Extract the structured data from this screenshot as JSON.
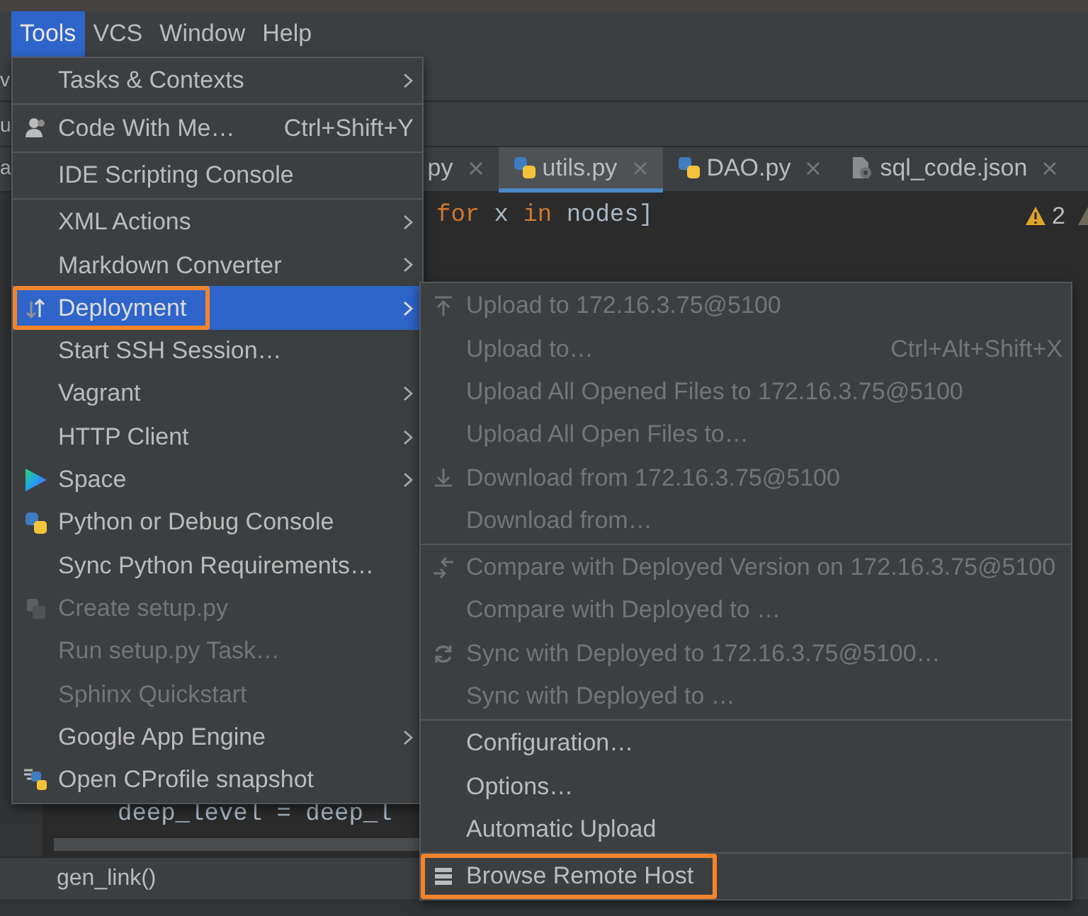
{
  "menubar": [
    {
      "label": "Tools",
      "selected": true
    },
    {
      "label": "VCS",
      "selected": false
    },
    {
      "label": "Window",
      "selected": false
    },
    {
      "label": "Help",
      "selected": false
    }
  ],
  "toolbar_fragments": [
    "v",
    "u"
  ],
  "tabs": [
    {
      "label": "a",
      "selected": false,
      "kind": "plain",
      "closable": false
    },
    {
      "label": "py",
      "selected": false,
      "kind": "plain",
      "closable": true
    },
    {
      "label": "utils.py",
      "selected": true,
      "kind": "python",
      "closable": true
    },
    {
      "label": "DAO.py",
      "selected": false,
      "kind": "python",
      "closable": true
    },
    {
      "label": "sql_code.json",
      "selected": false,
      "kind": "json",
      "closable": true
    }
  ],
  "editor": {
    "lines": [
      [
        {
          "text": "for",
          "kind": "keyword"
        },
        {
          "text": " x ",
          "kind": "plain"
        },
        {
          "text": "in",
          "kind": "keyword"
        },
        {
          "text": " nodes]",
          "kind": "plain"
        }
      ],
      [
        {
          "text": "deep_level = deep_l",
          "kind": "plain"
        }
      ]
    ],
    "warning_count": "2"
  },
  "breadcrumb": "gen_link()",
  "tools_menu": {
    "sections": [
      {
        "items": [
          {
            "label": "Tasks & Contexts",
            "kind": "none",
            "has_submenu": true,
            "disabled": false,
            "selected": false
          }
        ]
      },
      {
        "items": [
          {
            "label": "Code With Me…",
            "kind": "person",
            "shortcut": "Ctrl+Shift+Y",
            "has_submenu": false,
            "disabled": false,
            "selected": false
          }
        ]
      },
      {
        "items": [
          {
            "label": "IDE Scripting Console",
            "kind": "none",
            "has_submenu": false,
            "disabled": false,
            "selected": false
          }
        ]
      },
      {
        "items": [
          {
            "label": "XML Actions",
            "kind": "none",
            "has_submenu": true,
            "disabled": false,
            "selected": false
          },
          {
            "label": "Markdown Converter",
            "kind": "none",
            "has_submenu": true,
            "disabled": false,
            "selected": false
          },
          {
            "label": "Deployment",
            "kind": "deploy",
            "has_submenu": true,
            "disabled": false,
            "selected": true,
            "annotated": true
          },
          {
            "label": "Start SSH Session…",
            "kind": "none",
            "has_submenu": false,
            "disabled": false,
            "selected": false
          },
          {
            "label": "Vagrant",
            "kind": "none",
            "has_submenu": true,
            "disabled": false,
            "selected": false
          },
          {
            "label": "HTTP Client",
            "kind": "none",
            "has_submenu": true,
            "disabled": false,
            "selected": false
          },
          {
            "label": "Space",
            "kind": "space",
            "has_submenu": true,
            "disabled": false,
            "selected": false
          },
          {
            "label": "Python or Debug Console",
            "kind": "python",
            "has_submenu": false,
            "disabled": false,
            "selected": false
          },
          {
            "label": "Sync Python Requirements…",
            "kind": "none",
            "has_submenu": false,
            "disabled": false,
            "selected": false
          },
          {
            "label": "Create setup.py",
            "kind": "package",
            "has_submenu": false,
            "disabled": true,
            "selected": false
          },
          {
            "label": "Run setup.py Task…",
            "kind": "none",
            "has_submenu": false,
            "disabled": true,
            "selected": false
          },
          {
            "label": "Sphinx Quickstart",
            "kind": "none",
            "has_submenu": false,
            "disabled": true,
            "selected": false
          },
          {
            "label": "Google App Engine",
            "kind": "none",
            "has_submenu": true,
            "disabled": false,
            "selected": false
          },
          {
            "label": "Open CProfile snapshot",
            "kind": "profile",
            "has_submenu": false,
            "disabled": false,
            "selected": false
          }
        ]
      }
    ]
  },
  "deployment_submenu": {
    "sections": [
      {
        "items": [
          {
            "label": "Upload to 172.16.3.75@5100",
            "kind": "upload",
            "disabled": true
          },
          {
            "label": "Upload to…",
            "kind": "none",
            "shortcut": "Ctrl+Alt+Shift+X",
            "disabled": true
          },
          {
            "label": "Upload All Opened Files to 172.16.3.75@5100",
            "kind": "none",
            "disabled": true
          },
          {
            "label": "Upload All Open Files to…",
            "kind": "none",
            "disabled": true
          },
          {
            "label": "Download from 172.16.3.75@5100",
            "kind": "download",
            "disabled": true
          },
          {
            "label": "Download from…",
            "kind": "none",
            "disabled": true
          }
        ]
      },
      {
        "items": [
          {
            "label": "Compare with Deployed Version on 172.16.3.75@5100",
            "kind": "compare",
            "disabled": true
          },
          {
            "label": "Compare with Deployed to …",
            "kind": "none",
            "disabled": true
          },
          {
            "label": "Sync with Deployed to 172.16.3.75@5100…",
            "kind": "sync",
            "disabled": true
          },
          {
            "label": "Sync with Deployed to …",
            "kind": "none",
            "disabled": true
          }
        ]
      },
      {
        "items": [
          {
            "label": "Configuration…",
            "kind": "none",
            "disabled": false
          },
          {
            "label": "Options…",
            "kind": "none",
            "disabled": false
          },
          {
            "label": "Automatic Upload",
            "kind": "none",
            "disabled": false
          }
        ]
      },
      {
        "items": [
          {
            "label": "Browse Remote Host",
            "kind": "server",
            "disabled": false,
            "annotated": true
          }
        ]
      }
    ]
  }
}
